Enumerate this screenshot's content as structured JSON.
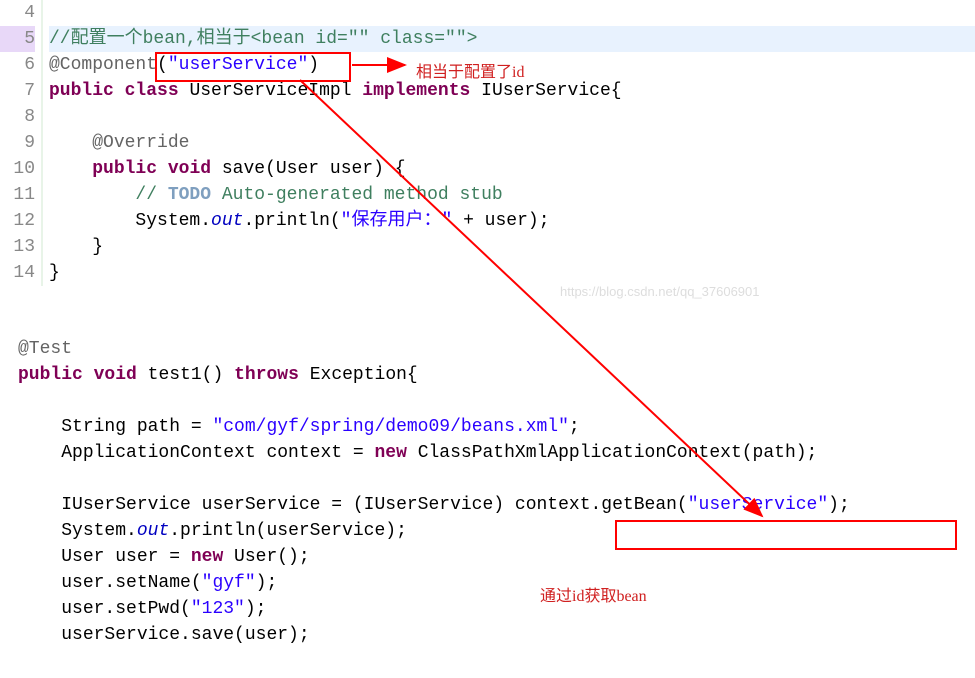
{
  "block1": {
    "gutter": [
      "4",
      "5",
      "6",
      "7",
      "8",
      "9",
      "10",
      "11",
      "12",
      "13",
      "14"
    ],
    "line5": {
      "prefix": "//",
      "text": "配置一个bean,相当于<bean id=\"\" class=\"\">"
    },
    "line6": {
      "ann": "@Component",
      "lp": "(",
      "str": "\"userService\"",
      "rp": ")"
    },
    "line7": {
      "k1": "public",
      "k2": "class",
      "cls": "UserServiceImpl",
      "k3": "implements",
      "iface": "IUserService{"
    },
    "line9": {
      "ann": "@Override"
    },
    "line10": {
      "k1": "public",
      "k2": "void",
      "sig": "save(User user) {"
    },
    "line11": {
      "slashes": "// ",
      "todo": "TODO",
      "rest": " Auto-generated method stub"
    },
    "line12": {
      "sys": "System.",
      "out": "out",
      "mid": ".println(",
      "str": "\"保存用户：\"",
      "tail": " + user);"
    },
    "line13": {
      "brace": "}"
    },
    "line14": {
      "brace": "}"
    }
  },
  "block2": {
    "l1": {
      "ann": "@Test"
    },
    "l2": {
      "k1": "public",
      "k2": "void",
      "name": "test1()",
      "k3": "throws",
      "ex": "Exception{"
    },
    "l4": {
      "pre": "String path = ",
      "str": "\"com/gyf/spring/demo09/beans.xml\"",
      "post": ";"
    },
    "l5": {
      "pre": "ApplicationContext context = ",
      "knew": "new",
      "post": " ClassPathXmlApplicationContext(path);"
    },
    "l7": {
      "pre": "IUserService userService = (IUserService) context.getBean(",
      "str": "\"userService\"",
      "post": ");"
    },
    "l8": {
      "sys": "System.",
      "out": "out",
      "post": ".println(userService);"
    },
    "l9": {
      "pre": "User user = ",
      "knew": "new",
      "post": " User();"
    },
    "l10": {
      "pre": "user.setName(",
      "str": "\"gyf\"",
      "post": ");"
    },
    "l11": {
      "pre": "user.setPwd(",
      "str": "\"123\"",
      "post": ");"
    },
    "l12": {
      "txt": "userService.save(user);"
    }
  },
  "annotations": {
    "a1": "相当于配置了id",
    "a2": "通过id获取bean"
  },
  "watermark": "https://blog.csdn.net/qq_37606901"
}
